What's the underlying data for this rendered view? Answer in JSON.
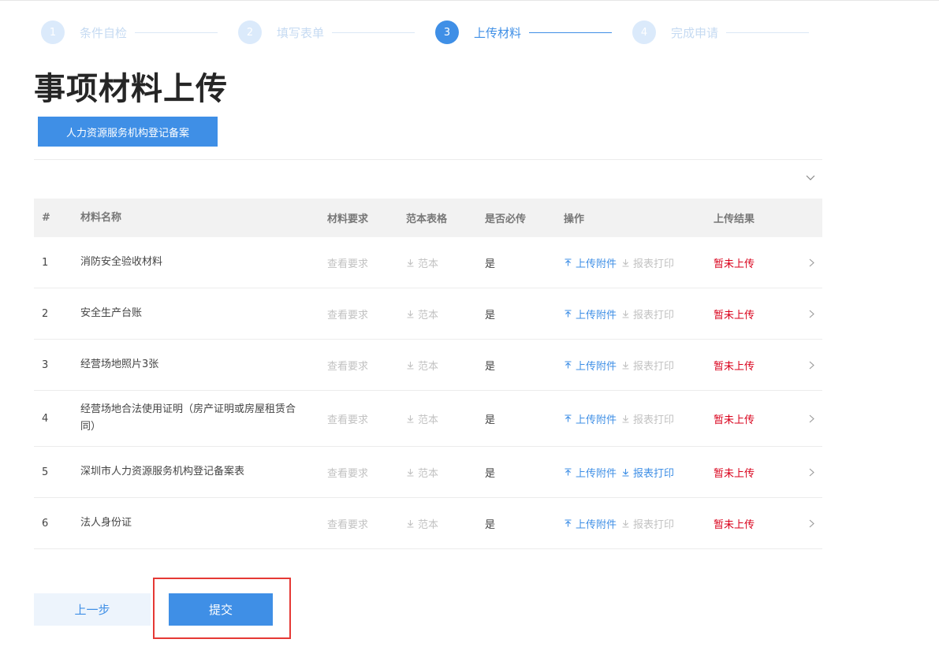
{
  "steps": [
    {
      "num": "1",
      "label": "条件自检",
      "active": false
    },
    {
      "num": "2",
      "label": "填写表单",
      "active": false
    },
    {
      "num": "3",
      "label": "上传材料",
      "active": true
    },
    {
      "num": "4",
      "label": "完成申请",
      "active": false
    }
  ],
  "page": {
    "title": "事项材料上传",
    "item_tag": "人力资源服务机构登记备案"
  },
  "table": {
    "headers": {
      "no": "#",
      "name": "材料名称",
      "requirement": "材料要求",
      "template": "范本表格",
      "required": "是否必传",
      "operation": "操作",
      "result": "上传结果"
    },
    "rows": [
      {
        "no": "1",
        "name": "消防安全验收材料",
        "requirement": "查看要求",
        "template": "范本",
        "required": "是",
        "upload": "上传附件",
        "print": "报表打印",
        "print_enabled": false,
        "result": "暂未上传"
      },
      {
        "no": "2",
        "name": "安全生产台账",
        "requirement": "查看要求",
        "template": "范本",
        "required": "是",
        "upload": "上传附件",
        "print": "报表打印",
        "print_enabled": false,
        "result": "暂未上传"
      },
      {
        "no": "3",
        "name": "经营场地照片3张",
        "requirement": "查看要求",
        "template": "范本",
        "required": "是",
        "upload": "上传附件",
        "print": "报表打印",
        "print_enabled": false,
        "result": "暂未上传"
      },
      {
        "no": "4",
        "name": "经营场地合法使用证明（房产证明或房屋租赁合同）",
        "requirement": "查看要求",
        "template": "范本",
        "required": "是",
        "upload": "上传附件",
        "print": "报表打印",
        "print_enabled": false,
        "result": "暂未上传"
      },
      {
        "no": "5",
        "name": "深圳市人力资源服务机构登记备案表",
        "requirement": "查看要求",
        "template": "范本",
        "required": "是",
        "upload": "上传附件",
        "print": "报表打印",
        "print_enabled": true,
        "result": "暂未上传"
      },
      {
        "no": "6",
        "name": "法人身份证",
        "requirement": "查看要求",
        "template": "范本",
        "required": "是",
        "upload": "上传附件",
        "print": "报表打印",
        "print_enabled": false,
        "result": "暂未上传"
      }
    ]
  },
  "buttons": {
    "prev": "上一步",
    "submit": "提交"
  },
  "colors": {
    "accent": "#3f8fe6",
    "step_inactive": "#dbeafb",
    "status_red": "#d9001b",
    "highlight_frame": "#e53935"
  },
  "icons": {
    "download": "download-icon",
    "upload": "upload-icon",
    "chevron_right": "chevron-right-icon",
    "chevron_down": "chevron-down-icon"
  }
}
